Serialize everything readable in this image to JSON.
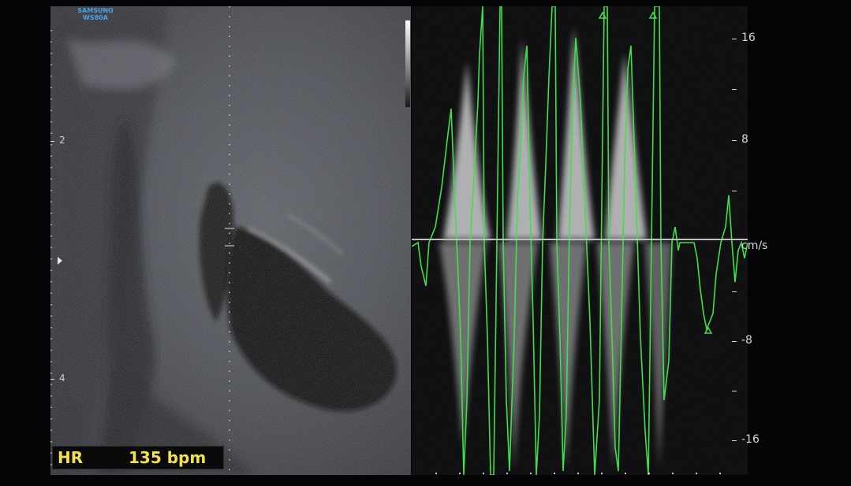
{
  "logo": {
    "line1": "SAMSUNG",
    "line2": "WS80A"
  },
  "bmode": {
    "depth_labels": [
      "2",
      "4"
    ]
  },
  "heart_rate": {
    "label": "HR",
    "value": "135 bpm"
  },
  "doppler": {
    "velocity_labels": [
      "16",
      "8",
      "-8",
      "-16"
    ],
    "unit": "cm/s",
    "trace_color": "#3fe04a"
  }
}
